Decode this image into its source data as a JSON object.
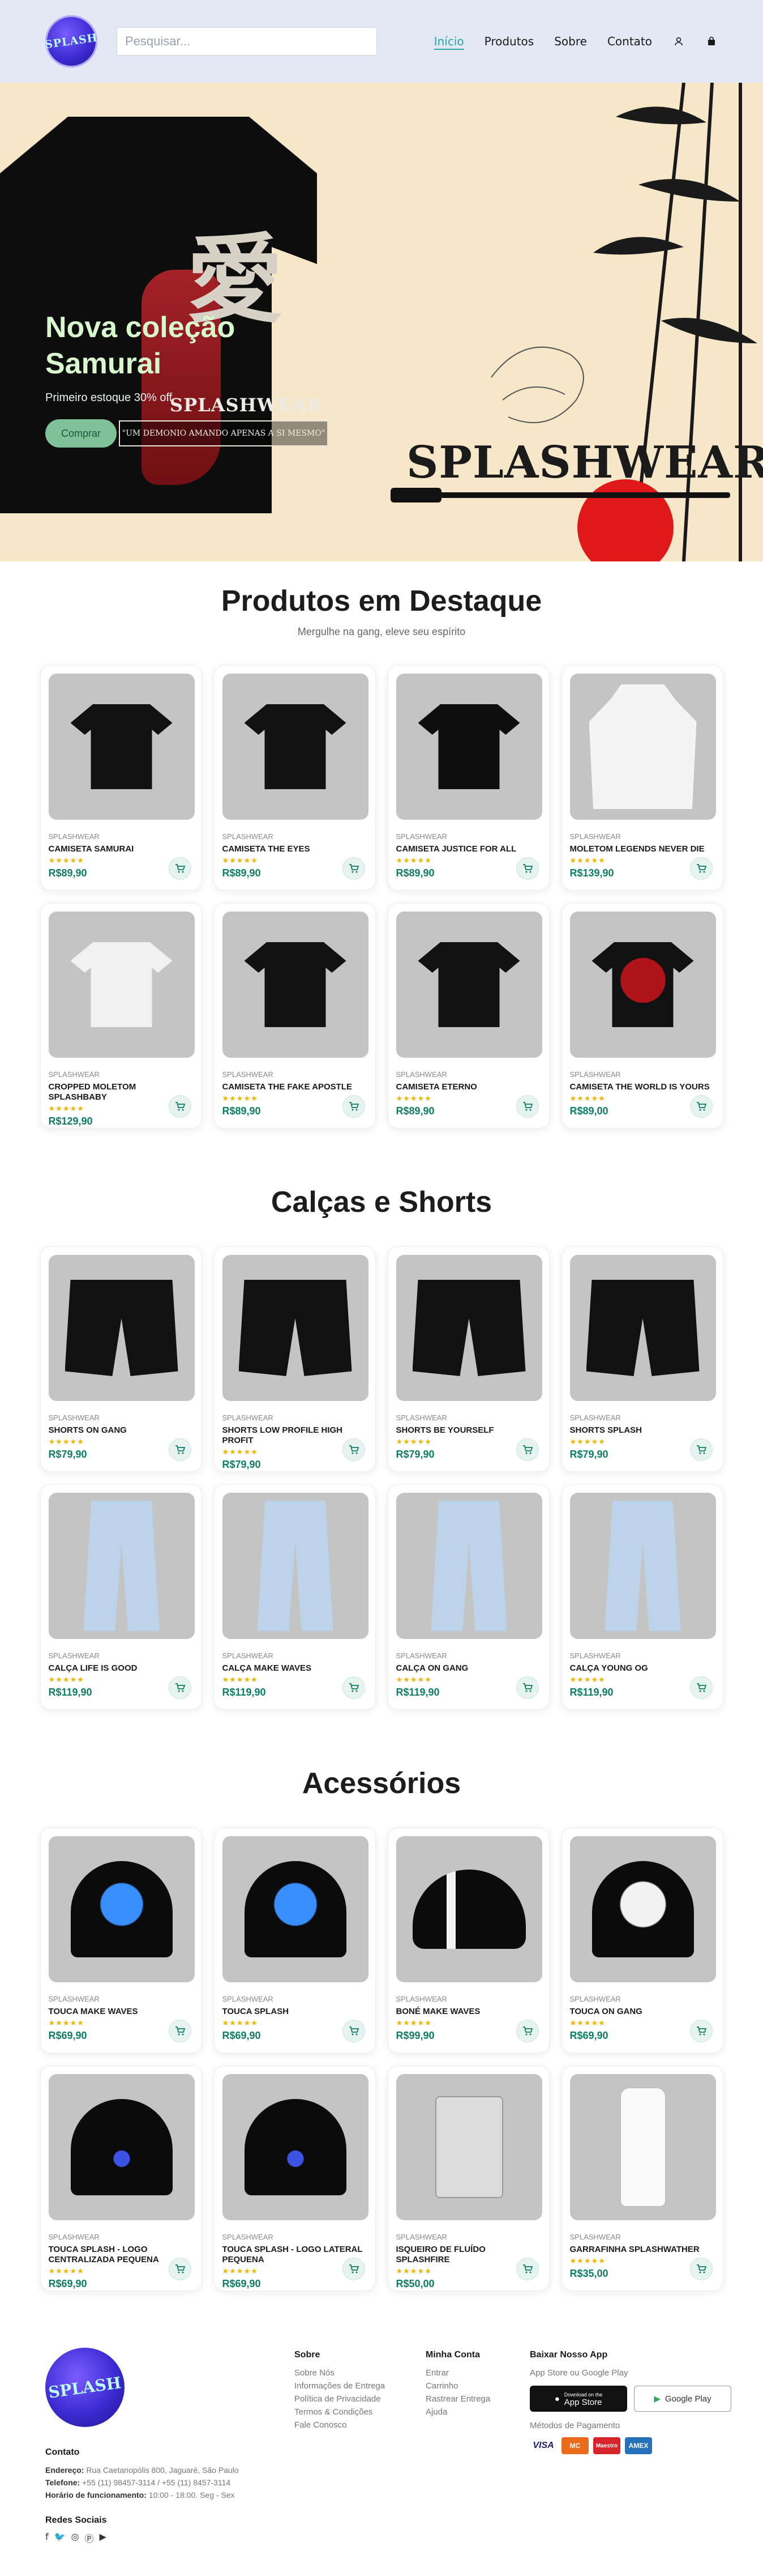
{
  "header": {
    "logo_text": "SPLASH",
    "search_placeholder": "Pesquisar...",
    "nav": [
      {
        "label": "Início",
        "active": true
      },
      {
        "label": "Produtos",
        "active": false
      },
      {
        "label": "Sobre",
        "active": false
      },
      {
        "label": "Contato",
        "active": false
      }
    ],
    "icons": [
      "user-icon",
      "bag-icon"
    ]
  },
  "hero": {
    "title_line1": "Nova coleção",
    "title_line2": "Samurai",
    "subtitle": "Primeiro estoque 30% off",
    "cta": "Comprar",
    "print_brand": "SPLASHWEAR",
    "tagline": "\"UM DEMONIO AMANDO APENAS A SI MESMO\"",
    "big_brand": "SPLASHWEAR",
    "kanji": "愛"
  },
  "featured": {
    "title": "Produtos em Destaque",
    "subtitle": "Mergulhe na gang, eleve seu espírito",
    "products": [
      {
        "brand": "SPLASHWEAR",
        "name": "CAMISETA SAMURAI",
        "price": "R$89,90",
        "art": "shirt-black"
      },
      {
        "brand": "SPLASHWEAR",
        "name": "CAMISETA THE EYES",
        "price": "R$89,90",
        "art": "shirt-black"
      },
      {
        "brand": "SPLASHWEAR",
        "name": "CAMISETA JUSTICE FOR ALL",
        "price": "R$89,90",
        "art": "shirt-justice"
      },
      {
        "brand": "SPLASHWEAR",
        "name": "MOLETOM LEGENDS NEVER DIE",
        "price": "R$139,90",
        "art": "hoodie"
      },
      {
        "brand": "SPLASHWEAR",
        "name": "CROPPED MOLETOM SPLASHBABY",
        "price": "R$129,90",
        "art": "shirt-white"
      },
      {
        "brand": "SPLASHWEAR",
        "name": "CAMISETA THE FAKE APOSTLE",
        "price": "R$89,90",
        "art": "shirt-black"
      },
      {
        "brand": "SPLASHWEAR",
        "name": "CAMISETA ETERNO",
        "price": "R$89,90",
        "art": "shirt-black"
      },
      {
        "brand": "SPLASHWEAR",
        "name": "CAMISETA THE WORLD IS YOURS",
        "price": "R$89,00",
        "art": "shirt-world"
      }
    ]
  },
  "pants": {
    "title": "Calças e Shorts",
    "products": [
      {
        "brand": "SPLASHWEAR",
        "name": "SHORTS ON GANG",
        "price": "R$79,90",
        "art": "shorts"
      },
      {
        "brand": "SPLASHWEAR",
        "name": "SHORTS LOW PROFILE HIGH PROFIT",
        "price": "R$79,90",
        "art": "shorts"
      },
      {
        "brand": "SPLASHWEAR",
        "name": "SHORTS BE YOURSELF",
        "price": "R$79,90",
        "art": "shorts"
      },
      {
        "brand": "SPLASHWEAR",
        "name": "SHORTS SPLASH",
        "price": "R$79,90",
        "art": "shorts"
      },
      {
        "brand": "SPLASHWEAR",
        "name": "CALÇA LIFE IS GOOD",
        "price": "R$119,90",
        "art": "jeans"
      },
      {
        "brand": "SPLASHWEAR",
        "name": "CALÇA MAKE WAVES",
        "price": "R$119,90",
        "art": "jeans"
      },
      {
        "brand": "SPLASHWEAR",
        "name": "CALÇA ON GANG",
        "price": "R$119,90",
        "art": "jeans"
      },
      {
        "brand": "SPLASHWEAR",
        "name": "CALÇA YOUNG OG",
        "price": "R$119,90",
        "art": "jeans"
      }
    ]
  },
  "accessories": {
    "title": "Acessórios",
    "products": [
      {
        "brand": "SPLASHWEAR",
        "name": "TOUCA MAKE WAVES",
        "price": "R$69,90",
        "art": "beanie-blue"
      },
      {
        "brand": "SPLASHWEAR",
        "name": "TOUCA SPLASH",
        "price": "R$69,90",
        "art": "beanie-blue"
      },
      {
        "brand": "SPLASHWEAR",
        "name": "BONÉ MAKE WAVES",
        "price": "R$99,90",
        "art": "cap"
      },
      {
        "brand": "SPLASHWEAR",
        "name": "TOUCA ON GANG",
        "price": "R$69,90",
        "art": "beanie-white"
      },
      {
        "brand": "SPLASHWEAR",
        "name": "TOUCA SPLASH - LOGO CENTRALIZADA PEQUENA",
        "price": "R$69,90",
        "art": "beanie"
      },
      {
        "brand": "SPLASHWEAR",
        "name": "TOUCA SPLASH - LOGO LATERAL PEQUENA",
        "price": "R$69,90",
        "art": "beanie"
      },
      {
        "brand": "SPLASHWEAR",
        "name": "ISQUEIRO DE FLUÍDO SPLASHFIRE",
        "price": "R$50,00",
        "art": "zippo"
      },
      {
        "brand": "SPLASHWEAR",
        "name": "GARRAFINHA SPLASHWATHER",
        "price": "R$35,00",
        "art": "bottle"
      }
    ]
  },
  "stars": "★★★★★",
  "footer": {
    "logo_text": "SPLASH",
    "contact_title": "Contato",
    "address_label": "Endereço:",
    "address": "Rua Caetanopólis 800, Jaguaré, São Paulo",
    "phone_label": "Telefone:",
    "phone": "+55 (11) 98457-3114 / +55 (11) 8457-3114",
    "hours_label": "Horário de funcionamento:",
    "hours": "10:00 - 18:00. Seg - Sex",
    "social_title": "Redes Sociais",
    "about_title": "Sobre",
    "about_links": [
      "Sobre Nós",
      "Informações de Entrega",
      "Política de Privacidade",
      "Termos & Condições",
      "Fale Conosco"
    ],
    "account_title": "Minha Conta",
    "account_links": [
      "Entrar",
      "Carrinho",
      "Rastrear Entrega",
      "Ajuda"
    ],
    "app_title": "Baixar Nosso App",
    "app_sub": "App Store ou Google Play",
    "apple_label": "App Store",
    "apple_small": "Download on the",
    "google_label": "Google Play",
    "payment_title": "Métodos de Pagamento",
    "payment": [
      "VISA",
      "MC",
      "Maestro",
      "AMEX"
    ]
  },
  "colors": {
    "accent": "#27a8a0",
    "price": "#0d7d63",
    "header_bg": "#e4e8f5",
    "hero_bg": "#f6e7c9"
  }
}
